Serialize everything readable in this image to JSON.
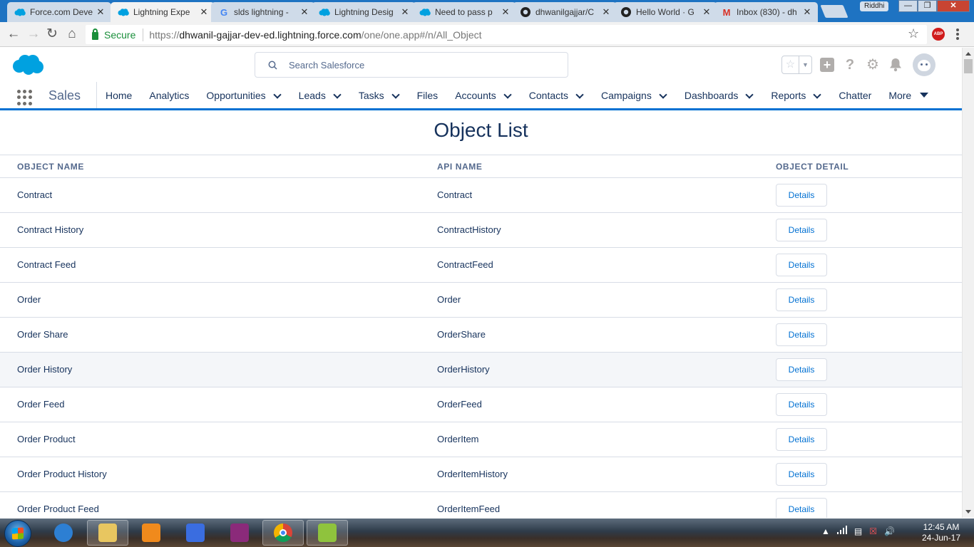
{
  "browser": {
    "tabs": [
      {
        "title": "Force.com Deve",
        "icon": "salesforce-icon",
        "active": false
      },
      {
        "title": "Lightning Expe",
        "icon": "salesforce-icon",
        "active": true
      },
      {
        "title": "slds lightning -",
        "icon": "google-icon",
        "active": false
      },
      {
        "title": "Lightning Desig",
        "icon": "salesforce-icon",
        "active": false
      },
      {
        "title": "Need to pass p",
        "icon": "salesforce-icon",
        "active": false
      },
      {
        "title": "dhwanilgajjar/C",
        "icon": "github-icon",
        "active": false
      },
      {
        "title": "Hello World · G",
        "icon": "github-icon",
        "active": false
      },
      {
        "title": "Inbox (830) - dh",
        "icon": "gmail-icon",
        "active": false
      }
    ],
    "profile_name": "Riddhi",
    "secure_label": "Secure",
    "url_scheme": "https://",
    "url_host": "dhwanil-gajjar-dev-ed.lightning.force.com",
    "url_path": "/one/one.app#/n/All_Object",
    "extension_label": "ABP"
  },
  "sf": {
    "search_placeholder": "Search Salesforce",
    "app_name": "Sales",
    "nav_items": [
      {
        "label": "Home",
        "dropdown": false
      },
      {
        "label": "Analytics",
        "dropdown": false
      },
      {
        "label": "Opportunities",
        "dropdown": true
      },
      {
        "label": "Leads",
        "dropdown": true
      },
      {
        "label": "Tasks",
        "dropdown": true
      },
      {
        "label": "Files",
        "dropdown": false
      },
      {
        "label": "Accounts",
        "dropdown": true
      },
      {
        "label": "Contacts",
        "dropdown": true
      },
      {
        "label": "Campaigns",
        "dropdown": true
      },
      {
        "label": "Dashboards",
        "dropdown": true
      },
      {
        "label": "Reports",
        "dropdown": true
      },
      {
        "label": "Chatter",
        "dropdown": false
      }
    ],
    "more_label": "More",
    "accent_color": "#0070d2",
    "text_color": "#16325c"
  },
  "page": {
    "title": "Object List",
    "columns": [
      "OBJECT NAME",
      "API NAME",
      "OBJECT DETAIL"
    ],
    "button_label": "Details",
    "rows": [
      {
        "name": "Contract",
        "api": "Contract"
      },
      {
        "name": "Contract History",
        "api": "ContractHistory"
      },
      {
        "name": "Contract Feed",
        "api": "ContractFeed"
      },
      {
        "name": "Order",
        "api": "Order"
      },
      {
        "name": "Order Share",
        "api": "OrderShare"
      },
      {
        "name": "Order History",
        "api": "OrderHistory",
        "hover": true
      },
      {
        "name": "Order Feed",
        "api": "OrderFeed"
      },
      {
        "name": "Order Product",
        "api": "OrderItem"
      },
      {
        "name": "Order Product History",
        "api": "OrderItemHistory"
      },
      {
        "name": "Order Product Feed",
        "api": "OrderItemFeed"
      }
    ]
  },
  "taskbar": {
    "apps": [
      {
        "name": "internet-explorer-icon",
        "open": false,
        "color": "#2d7fd3"
      },
      {
        "name": "file-explorer-icon",
        "open": true,
        "color": "#e8c660"
      },
      {
        "name": "media-player-icon",
        "open": false,
        "color": "#f08a1c"
      },
      {
        "name": "d-app-icon",
        "open": false,
        "color": "#3a6de0"
      },
      {
        "name": "winrar-icon",
        "open": false,
        "color": "#8b2a7a"
      },
      {
        "name": "chrome-icon",
        "open": true,
        "color": "#db4437"
      },
      {
        "name": "notepad-plus-icon",
        "open": true,
        "color": "#8fc33d"
      }
    ],
    "time": "12:45 AM",
    "date": "24-Jun-17"
  }
}
